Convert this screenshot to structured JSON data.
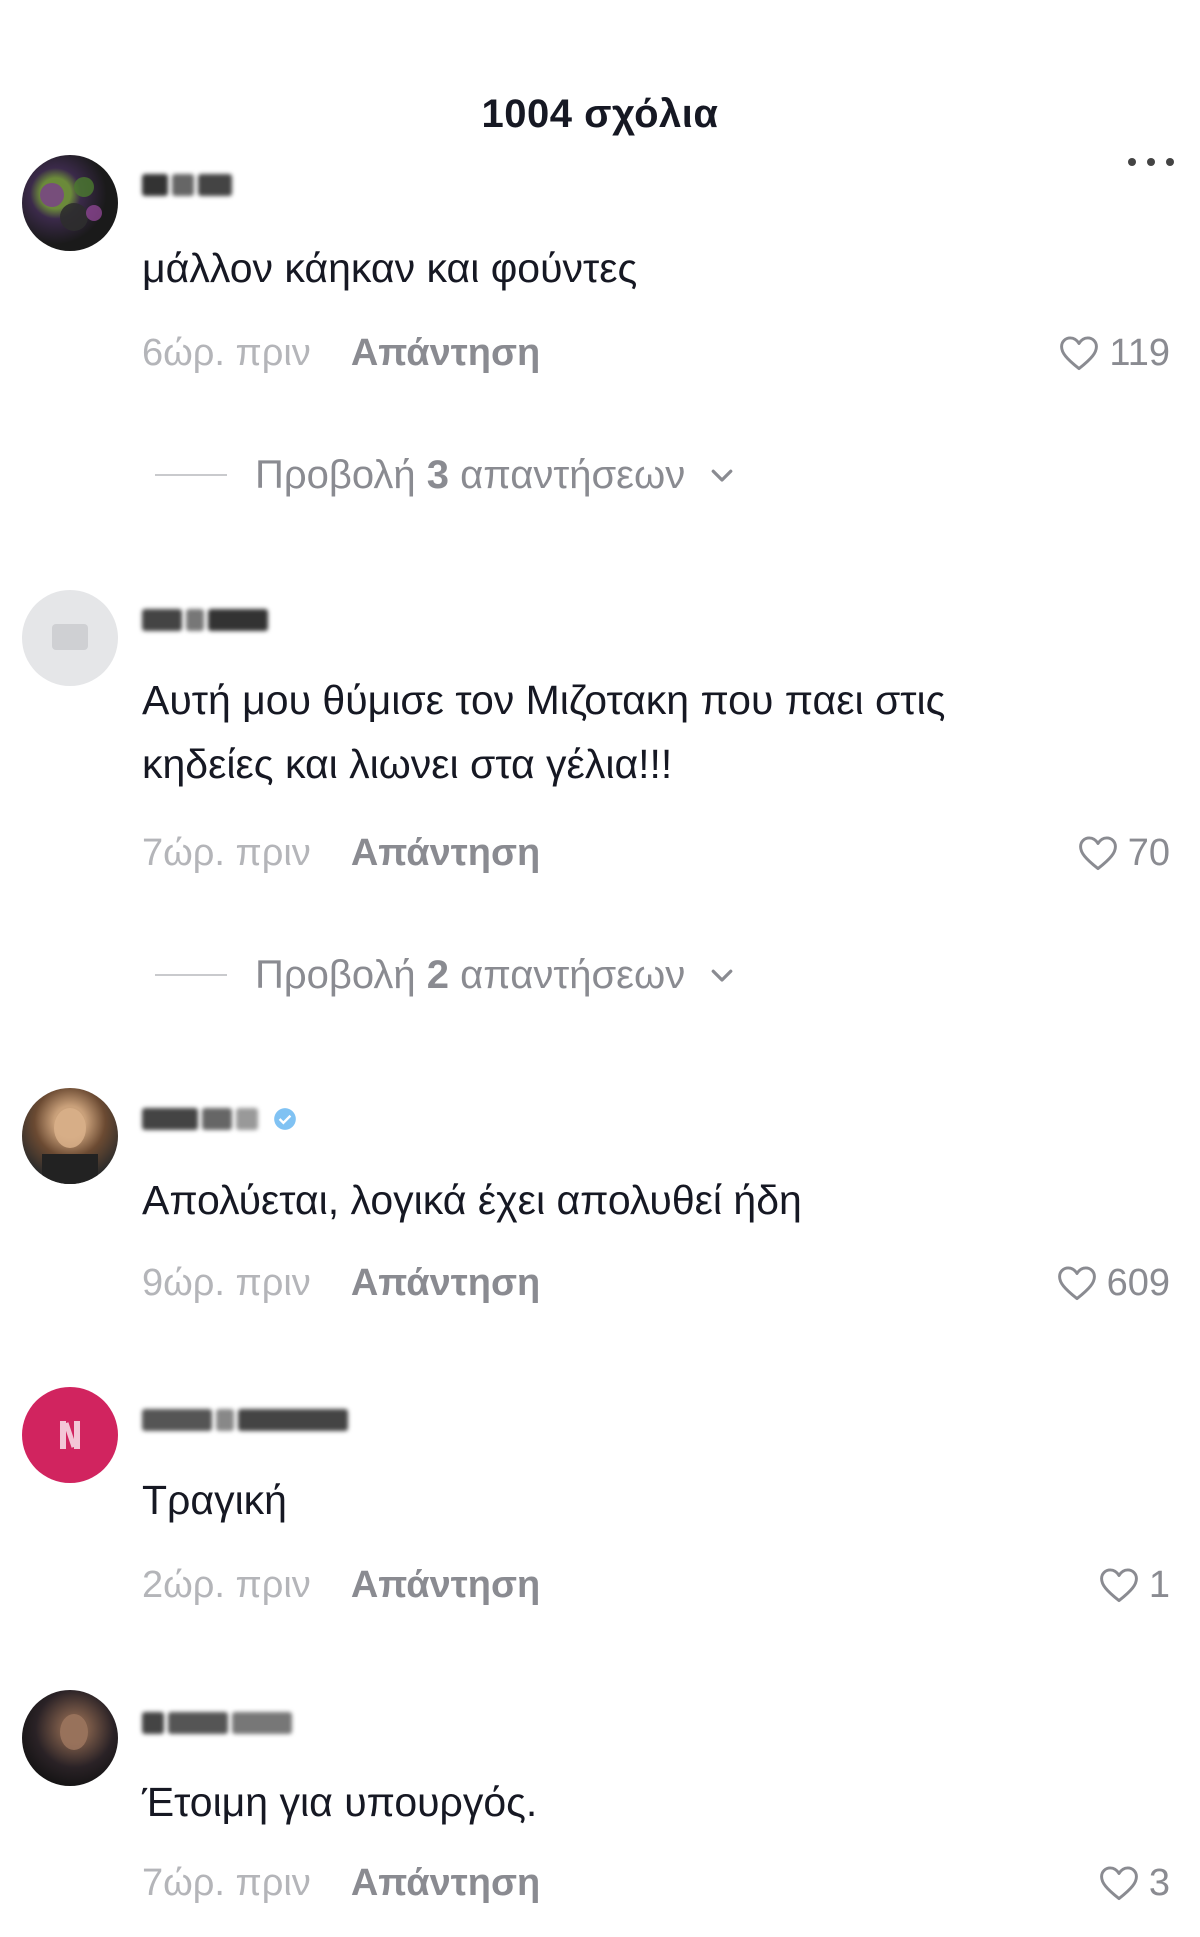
{
  "header": {
    "title": "1004 σχόλια"
  },
  "menu": {
    "icon": "more-horizontal-icon"
  },
  "comments": [
    {
      "text": "μάλλον κάηκαν και φούντες",
      "time": "6ώρ. πριν",
      "reply": "Απάντηση",
      "likes": "119",
      "view_replies": {
        "prefix": "Προβολή ",
        "count": "3",
        "suffix": " απαντήσεων"
      }
    },
    {
      "text": "Αυτή μου θύμισε τον Μιζοτακη που παει στις κηδείες και λιωνει στα γέλια!!!",
      "time": "7ώρ. πριν",
      "reply": "Απάντηση",
      "likes": "70",
      "view_replies": {
        "prefix": "Προβολή ",
        "count": "2",
        "suffix": " απαντήσεων"
      }
    },
    {
      "text": "Απολύεται, λογικά έχει απολυθεί ήδη",
      "time": "9ώρ. πριν",
      "reply": "Απάντηση",
      "likes": "609"
    },
    {
      "text": "Τραγική",
      "time": "2ώρ. πριν",
      "reply": "Απάντηση",
      "likes": "1"
    },
    {
      "text": "Έτοιμη για υπουργός.",
      "time": "7ώρ. πριν",
      "reply": "Απάντηση",
      "likes": "3"
    }
  ],
  "colors": {
    "text_primary": "#161823",
    "text_secondary": "#8a8b91",
    "text_time": "#b4b5b9",
    "avatar_pink": "#d1245f",
    "badge_blue": "#4aa8ee"
  }
}
